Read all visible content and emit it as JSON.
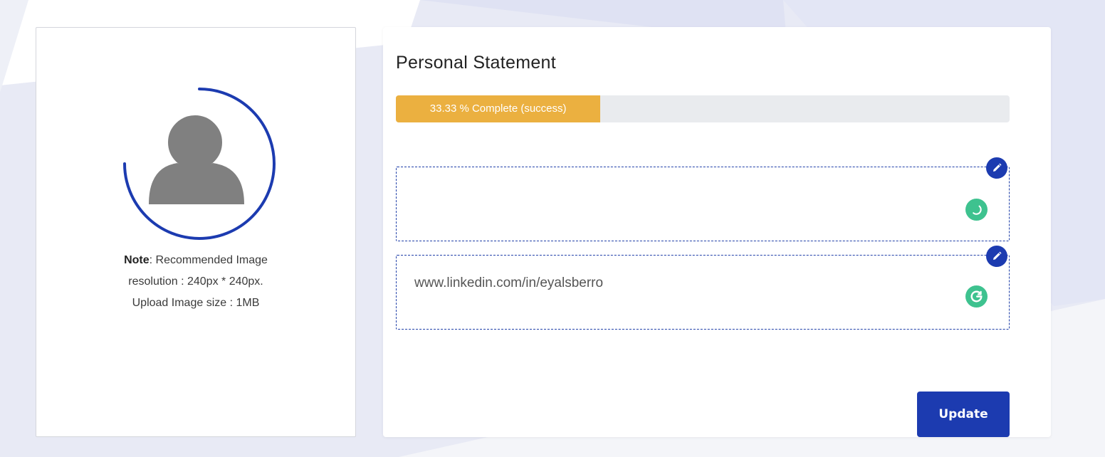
{
  "avatar": {
    "upload_progress": 0.75
  },
  "note": {
    "label": "Note",
    "line1": ": Recommended Image",
    "line2": "resolution : 240px * 240px.",
    "line3": "Upload Image size : 1MB"
  },
  "statement": {
    "title": "Personal Statement",
    "progress_text": "33.33 % Complete (success)",
    "progress_value": 33.33,
    "fields": [
      {
        "value": "",
        "loading": true
      },
      {
        "value": "www.linkedin.com/in/eyalsberro"
      }
    ],
    "update_label": "Update"
  },
  "colors": {
    "accent": "#1c3bb0",
    "progress": "#ebb040",
    "grammarly": "#3ec28f",
    "avatar_gray": "#808080"
  },
  "icons": [
    "pencil-icon",
    "grammarly-icon",
    "user-avatar-icon"
  ]
}
